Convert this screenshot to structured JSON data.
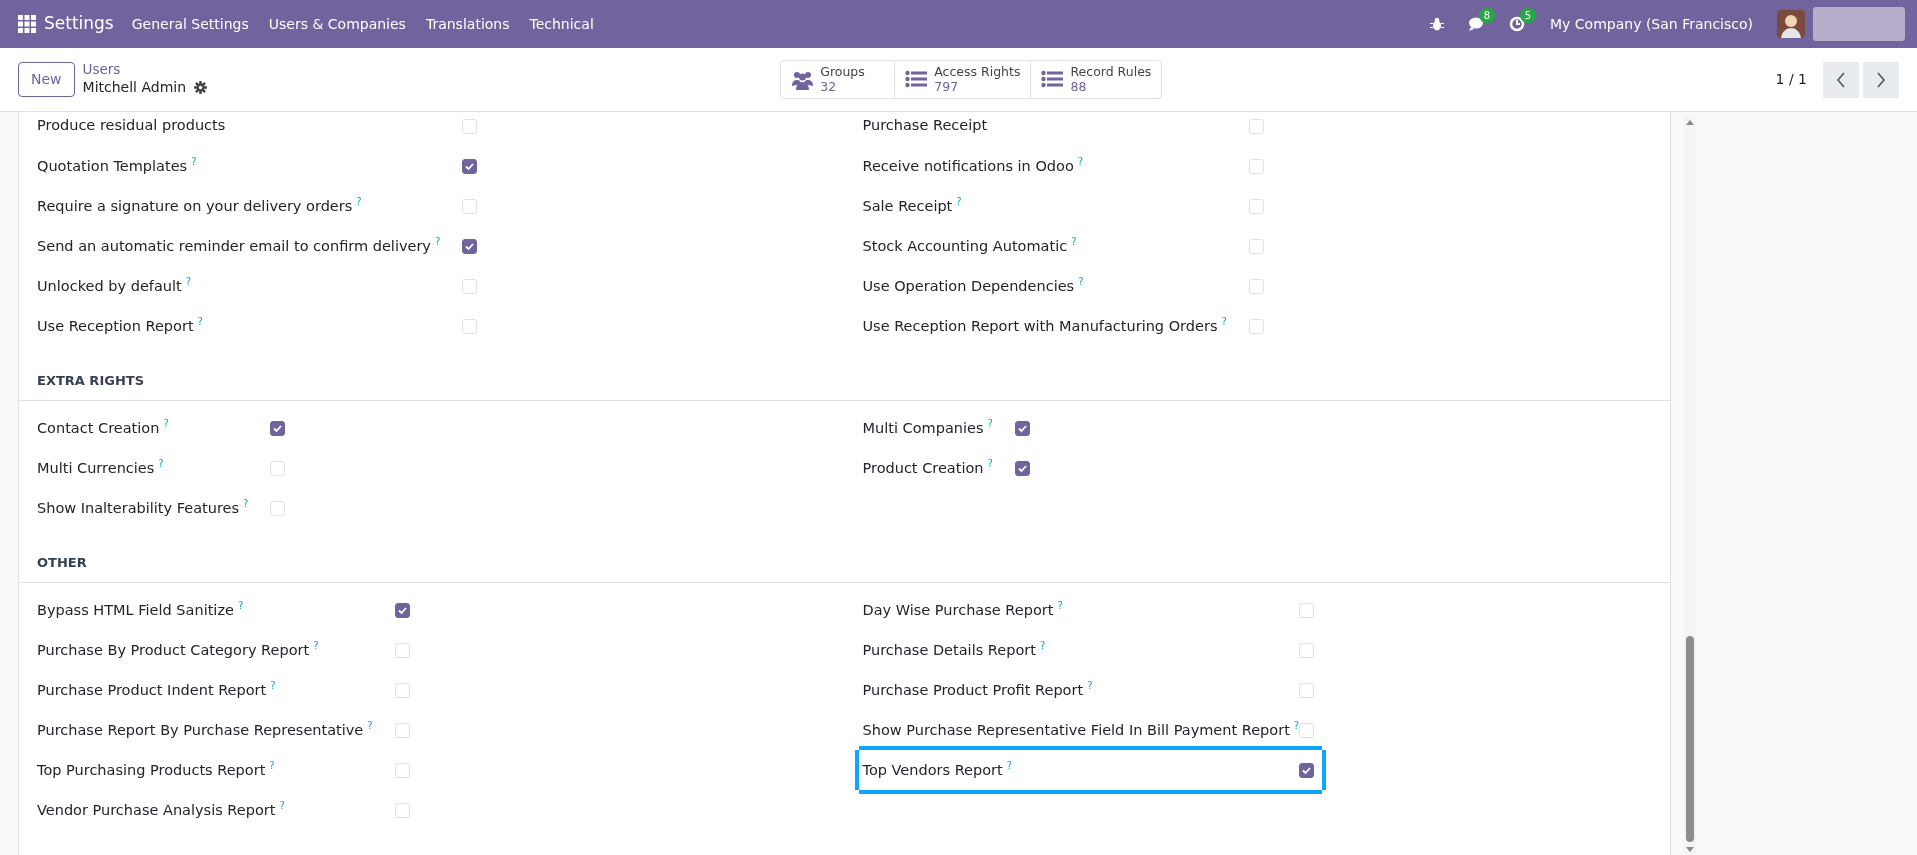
{
  "navbar": {
    "app": "Settings",
    "menu": [
      "General Settings",
      "Users & Companies",
      "Translations",
      "Technical"
    ],
    "badges": [
      {
        "kind": "chat",
        "count": "8"
      },
      {
        "kind": "activity",
        "count": "5"
      }
    ],
    "company": "My Company (San Francisco)"
  },
  "control_panel": {
    "new_button": "New",
    "breadcrumb": "Users",
    "record": "Mitchell Admin",
    "smart_buttons": [
      {
        "kind": "groups",
        "label": "Groups",
        "value": "32"
      },
      {
        "kind": "list",
        "label": "Access Rights",
        "value": "797"
      },
      {
        "kind": "list",
        "label": "Record Rules",
        "value": "88"
      }
    ],
    "pager": "1 / 1"
  },
  "sections": [
    {
      "left": [
        {
          "label": "Produce residual products",
          "checked": false
        },
        {
          "label": "Quotation Templates",
          "help": "?",
          "checked": true
        },
        {
          "label": "Require a signature on your delivery orders",
          "help": "?",
          "checked": false
        },
        {
          "label": "Send an automatic reminder email to confirm delivery",
          "help": "?",
          "checked": true
        },
        {
          "label": "Unlocked by default",
          "help": "?",
          "checked": false
        },
        {
          "label": "Use Reception Report",
          "help": "?",
          "checked": false
        }
      ],
      "right": [
        {
          "label": "Purchase Receipt",
          "checked": false
        },
        {
          "label": "Receive notifications in Odoo",
          "help": "?",
          "checked": false
        },
        {
          "label": "Sale Receipt",
          "help": "?",
          "checked": false
        },
        {
          "label": "Stock Accounting Automatic",
          "help": "?",
          "checked": false
        },
        {
          "label": "Use Operation Dependencies",
          "help": "?",
          "checked": false
        },
        {
          "label": "Use Reception Report with Manufacturing Orders",
          "help": "?",
          "checked": false
        }
      ]
    },
    {
      "title": "EXTRA RIGHTS",
      "left": [
        {
          "label": "Contact Creation",
          "help": "?",
          "checked": true
        },
        {
          "label": "Multi Currencies",
          "help": "?",
          "checked": false
        },
        {
          "label": "Show Inalterability Features",
          "help": "?",
          "checked": false
        }
      ],
      "right": [
        {
          "label": "Multi Companies",
          "help": "?",
          "checked": true
        },
        {
          "label": "Product Creation",
          "help": "?",
          "checked": true
        }
      ]
    },
    {
      "title": "OTHER",
      "left": [
        {
          "label": "Bypass HTML Field Sanitize",
          "help": "?",
          "checked": true
        },
        {
          "label": "Purchase By Product Category Report",
          "help": "?",
          "checked": false
        },
        {
          "label": "Purchase Product Indent Report",
          "help": "?",
          "checked": false
        },
        {
          "label": "Purchase Report By Purchase Representative",
          "help": "?",
          "checked": false
        },
        {
          "label": "Top Purchasing Products Report",
          "help": "?",
          "checked": false
        },
        {
          "label": "Vendor Purchase Analysis Report",
          "help": "?",
          "checked": false
        }
      ],
      "right": [
        {
          "label": "Day Wise Purchase Report",
          "help": "?",
          "checked": false
        },
        {
          "label": "Purchase Details Report",
          "help": "?",
          "checked": false
        },
        {
          "label": "Purchase Product Profit Report",
          "help": "?",
          "checked": false
        },
        {
          "label": "Show Purchase Representative Field In Bill Payment Report",
          "help": "?",
          "checked": false
        },
        {
          "label": "Top Vendors Report",
          "help": "?",
          "checked": true,
          "highlighted": true
        }
      ]
    }
  ]
}
